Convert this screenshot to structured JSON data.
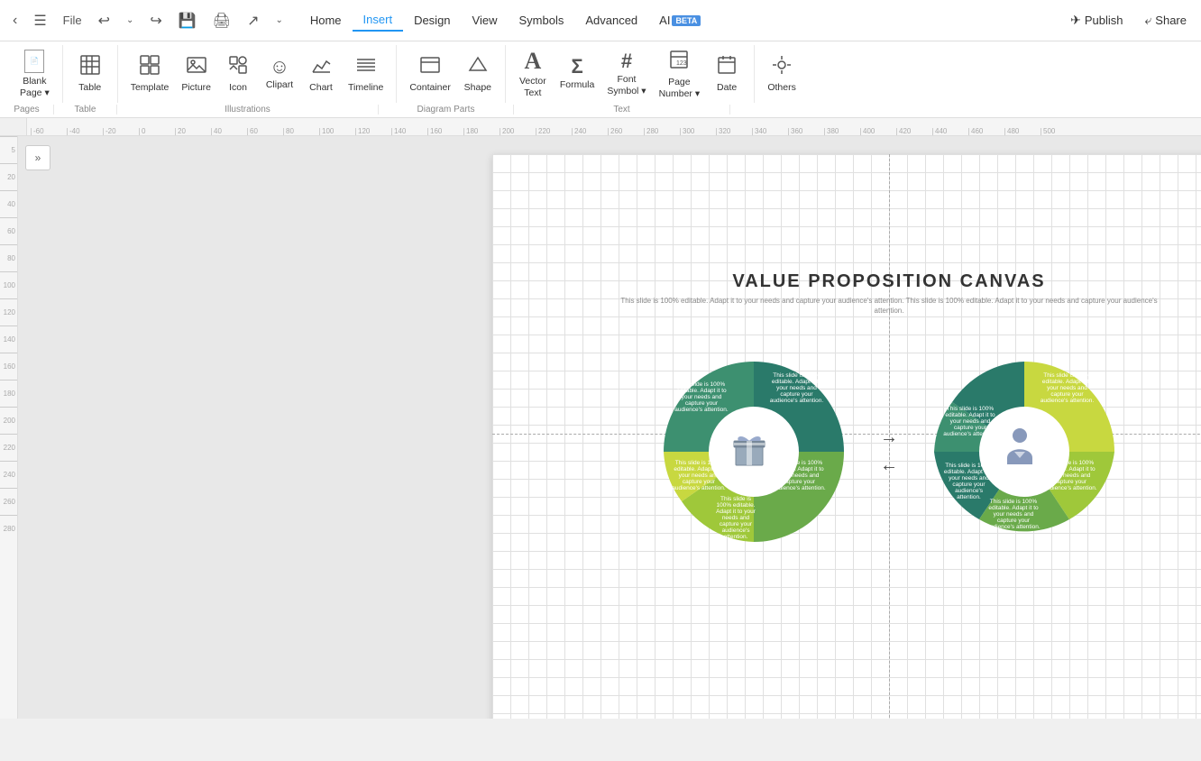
{
  "topbar": {
    "back_icon": "‹",
    "menu_icon": "☰",
    "file_label": "File",
    "undo_label": "↩",
    "redo_label": "↪",
    "save_icon": "💾",
    "print_icon": "🖨",
    "export_icon": "↗",
    "more_icon": "⌄",
    "menu_items": [
      "Home",
      "Insert",
      "Design",
      "View",
      "Symbols",
      "Advanced"
    ],
    "active_item": "Insert",
    "ai_badge": "BETA",
    "publish_label": "Publish",
    "share_label": "Share"
  },
  "ribbon": {
    "groups": {
      "pages": {
        "label": "Pages",
        "items": [
          {
            "id": "blank-page",
            "icon": "📄",
            "label": "Blank\nPage",
            "has_arrow": true
          }
        ]
      },
      "table": {
        "label": "Table",
        "items": [
          {
            "id": "table",
            "icon": "⊞",
            "label": "Table"
          }
        ]
      },
      "illustrations": {
        "label": "Illustrations",
        "items": [
          {
            "id": "template",
            "icon": "▦",
            "label": "Template"
          },
          {
            "id": "picture",
            "icon": "🖼",
            "label": "Picture"
          },
          {
            "id": "icon",
            "icon": "⊙",
            "label": "Icon"
          },
          {
            "id": "clipart",
            "icon": "☺",
            "label": "Clipart"
          },
          {
            "id": "chart",
            "icon": "📈",
            "label": "Chart"
          },
          {
            "id": "timeline",
            "icon": "☰",
            "label": "Timeline"
          }
        ]
      },
      "diagram": {
        "label": "Diagram Parts",
        "items": [
          {
            "id": "container",
            "icon": "▭",
            "label": "Container"
          },
          {
            "id": "shape",
            "icon": "⬡",
            "label": "Shape"
          }
        ]
      },
      "text": {
        "label": "Text",
        "items": [
          {
            "id": "vector-text",
            "icon": "A",
            "label": "Vector\nText"
          },
          {
            "id": "formula",
            "icon": "Σ",
            "label": "Formula"
          },
          {
            "id": "font-symbol",
            "icon": "#",
            "label": "Font\nSymbol",
            "has_arrow": true
          },
          {
            "id": "page-number",
            "icon": "⊟",
            "label": "Page\nNumber",
            "has_arrow": true
          },
          {
            "id": "date",
            "icon": "📅",
            "label": "Date"
          }
        ]
      },
      "others": {
        "label": "",
        "items": [
          {
            "id": "others",
            "icon": "🔗",
            "label": "Others"
          }
        ]
      }
    }
  },
  "ruler": {
    "h_ticks": [
      "-60",
      "-40",
      "-20",
      "0",
      "20",
      "40",
      "60",
      "80",
      "100",
      "120",
      "140",
      "160",
      "180",
      "200",
      "220",
      "240",
      "260",
      "280",
      "300",
      "320",
      "340",
      "360",
      "380",
      "400",
      "420",
      "440",
      "460",
      "480",
      "500"
    ],
    "v_ticks": [
      "5",
      "20",
      "40",
      "60",
      "80",
      "100",
      "120",
      "140",
      "160",
      "180",
      "200",
      "220",
      "240",
      "260",
      "280"
    ]
  },
  "canvas": {
    "title": "VALUE PROPOSITION CANVAS",
    "subtitle": "This slide is 100% editable. Adapt it to your needs and capture your audience's attention. This slide is 100% editable. Adapt it to your needs and capture your audience's attention.",
    "left_circle": {
      "center_icon": "gift",
      "segments": [
        {
          "label": "This slide is 100% editable. Adapt it to your needs and capture your audience's attention.",
          "color": "#2e7d6e",
          "position": "top"
        },
        {
          "label": "This slide is 100% editable. Adapt it to your needs and capture your audience's attention.",
          "color": "#558b4e",
          "position": "left"
        },
        {
          "label": "This slide is 100% editable. Adapt it to your needs and capture your audience's attention.",
          "color": "#8bae3c",
          "position": "bottom-left"
        },
        {
          "label": "This slide is 100% editable. Adapt it to your needs and capture your audience's attention.",
          "color": "#aec63e",
          "position": "bottom-right"
        }
      ]
    },
    "right_circle": {
      "center_icon": "person",
      "segments": [
        {
          "label": "This slide is 100% editable. Adapt it to your needs and capture your audience's attention.",
          "color": "#2e7d6e",
          "position": "top-left"
        },
        {
          "label": "This slide is 100% editable. Adapt it to your needs and capture your audience's attention.",
          "color": "#2e7d6e",
          "position": "top-right"
        },
        {
          "label": "This slide is 100% editable. Adapt it to your needs and capture your audience's attention.",
          "color": "#558b4e",
          "position": "right"
        },
        {
          "label": "This slide is 100% editable. Adapt it to your needs and capture your audience's attention.",
          "color": "#8bae3c",
          "position": "bottom-left"
        },
        {
          "label": "This slide is 100% editable. Adapt it to your needs and capture your audience's attention.",
          "color": "#aec63e",
          "position": "bottom"
        }
      ]
    },
    "arrows": {
      "right_arrow": "→",
      "left_arrow": "←"
    }
  },
  "sidebar": {
    "toggle_icon": "»"
  }
}
